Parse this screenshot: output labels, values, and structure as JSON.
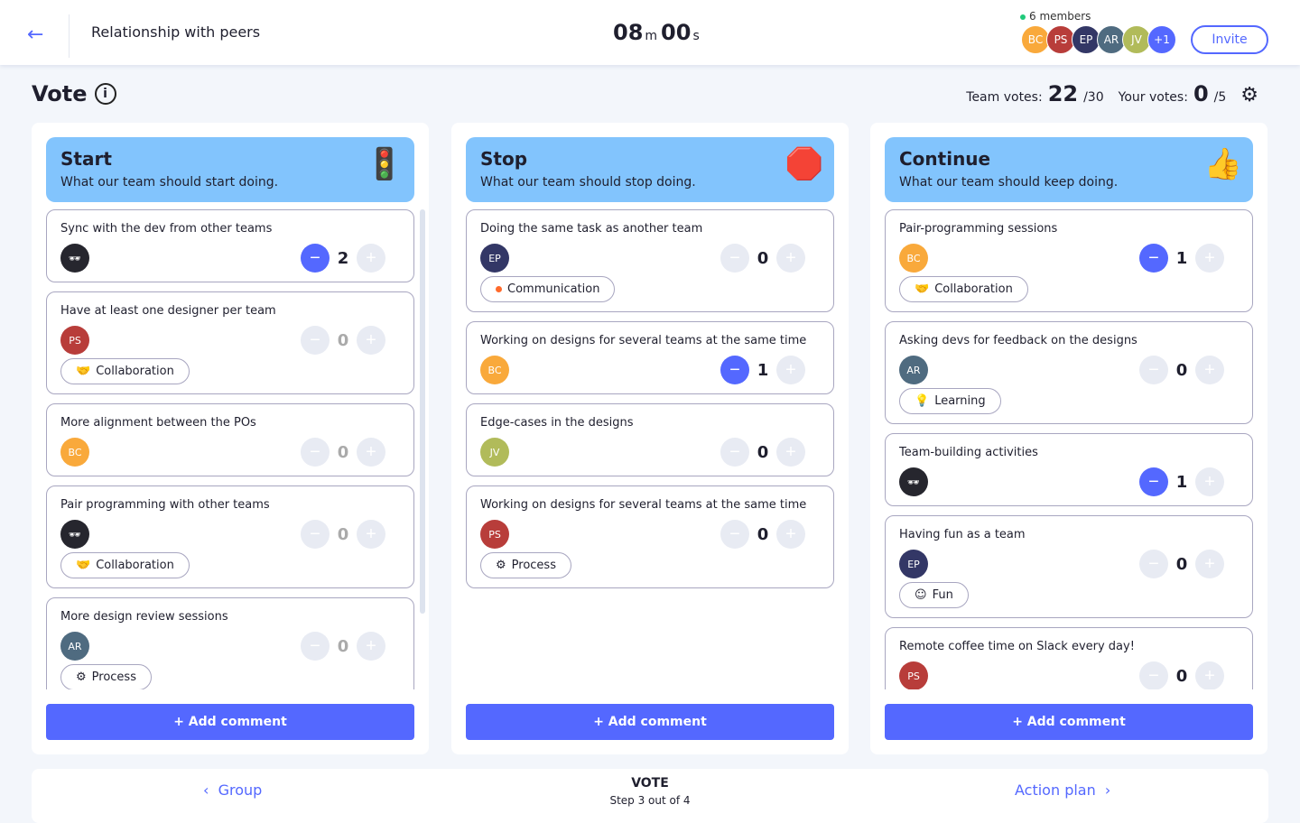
{
  "progress_percent": 75,
  "header": {
    "title": "Relationship with peers",
    "timer": {
      "minutes": "08",
      "m": "m",
      "seconds": "00",
      "s": "s"
    },
    "members_label": "6 members",
    "avatars": [
      {
        "label": "BC",
        "color": "#f9a93b"
      },
      {
        "label": "PS",
        "color": "#b83d3a"
      },
      {
        "label": "EP",
        "color": "#333766"
      },
      {
        "label": "AR",
        "color": "#4f6b80"
      },
      {
        "label": "JV",
        "color": "#b1bb5a"
      },
      {
        "label": "+1",
        "color": "#5468ff"
      }
    ],
    "invite_label": "Invite"
  },
  "page": {
    "title": "Vote",
    "team_votes_label": "Team votes:",
    "team_votes": "22",
    "team_votes_total": "/30",
    "your_votes_label": "Your votes:",
    "your_votes": "0",
    "your_votes_total": "/5"
  },
  "colors": {
    "accent": "#5468ff",
    "header_bg": "#82c4fd",
    "BC": "#f9a93b",
    "PS": "#b83d3a",
    "EP": "#333766",
    "AR": "#4f6b80",
    "JV": "#b1bb5a",
    "anon": "#26262e"
  },
  "columns": [
    {
      "title": "Start",
      "subtitle": "What our team should start doing.",
      "icon": "traffic-light-icon",
      "add_label": "+ Add comment",
      "cards": [
        {
          "text": "Sync with the dev from other teams",
          "author": "anon",
          "votes": "2",
          "voted": true
        },
        {
          "text": "Have at least one designer per team",
          "author": "PS",
          "votes": "0",
          "tag": "Collaboration",
          "tag_icon": "handshake-icon"
        },
        {
          "text": "More alignment between the POs",
          "author": "BC",
          "votes": "0"
        },
        {
          "text": "Pair programming with other teams",
          "author": "anon",
          "votes": "0",
          "tag": "Collaboration",
          "tag_icon": "handshake-icon"
        },
        {
          "text": "More design review sessions",
          "author": "AR",
          "votes": "0",
          "tag": "Process",
          "tag_icon": "gear-icon"
        }
      ]
    },
    {
      "title": "Stop",
      "subtitle": "What our team should stop doing.",
      "icon": "stop-sign-icon",
      "add_label": "+ Add comment",
      "cards": [
        {
          "text": "Doing the same task as another team",
          "author": "EP",
          "votes": "0",
          "tag": "Communication",
          "tag_icon": "dot-icon"
        },
        {
          "text": "Working on designs for several teams at the same time",
          "author": "BC",
          "votes": "1",
          "voted": true
        },
        {
          "text": "Edge-cases in the designs",
          "author": "JV",
          "votes": "0"
        },
        {
          "text": "Working on designs for several teams at the same time",
          "author": "PS",
          "votes": "0",
          "tag": "Process",
          "tag_icon": "gear-icon"
        }
      ]
    },
    {
      "title": "Continue",
      "subtitle": "What our team should keep doing.",
      "icon": "thumbs-up-icon",
      "add_label": "+ Add comment",
      "cards": [
        {
          "text": "Pair-programming sessions",
          "author": "BC",
          "votes": "1",
          "voted": true,
          "tag": "Collaboration",
          "tag_icon": "handshake-icon"
        },
        {
          "text": "Asking devs for feedback on the designs",
          "author": "AR",
          "votes": "0",
          "tag": "Learning",
          "tag_icon": "lightbulb-icon"
        },
        {
          "text": "Team-building activities",
          "author": "anon",
          "votes": "1",
          "voted": true
        },
        {
          "text": "Having fun as a team",
          "author": "EP",
          "votes": "0",
          "tag": "Fun",
          "tag_icon": "smiley-icon"
        },
        {
          "text": "Remote coffee time on Slack every day!",
          "author": "PS",
          "votes": "0"
        }
      ]
    }
  ],
  "footer": {
    "prev": "Group",
    "step_title": "VOTE",
    "step_sub": "Step 3 out of 4",
    "next": "Action plan"
  }
}
